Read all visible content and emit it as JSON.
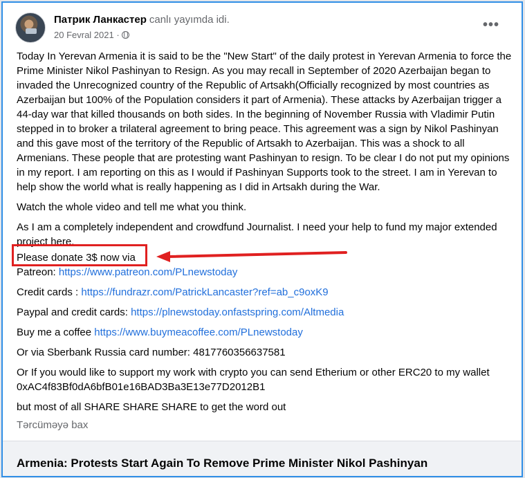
{
  "post": {
    "author_name": "Патрик Ланкастер",
    "author_status": "canlı yayımda idi.",
    "date": "20 Fevral 2021",
    "more_label": "•••",
    "paragraphs": {
      "p1": "Today In Yerevan Armenia it is said to be the  \"New Start\" of the daily protest in Yerevan Armenia to force the Prime Minister Nikol Pashinyan to Resign. As you may recall in September of 2020 Azerbaijan began to invaded the Unrecognized country of the Republic of Artsakh(Officially recognized by most countries as Azerbaijan but 100% of the Population considers it part of Armenia). These attacks by Azerbaijan trigger a 44-day war that killed thousands on both sides.  In the beginning of November Russia with Vladimir Putin stepped in to broker a trilateral agreement to bring peace.  This agreement was a sign by Nikol Pashinyan and this gave most of the territory of the Republic of Artsakh to Azerbaijan. This was a shock to all Armenians. These people that are protesting want Pashinyan to resign.  To be clear I do not put my opinions in my report. I am reporting on this as I would if Pashinyan Supports took to the street. I am in Yerevan to help show the world what is really happening as I did in Artsakh during the War.",
      "p2": "Watch the whole video and tell me what you think.",
      "p3": "As I am a completely independent and crowdfund Journalist. I need your help to fund my major extended project here.",
      "p4": "Please donate 3$ now via",
      "patreon_label": "Patreon: ",
      "patreon_link": "https://www.patreon.com/PLnewstoday",
      "cards_label": "Credit cards : ",
      "cards_link": "https://fundrazr.com/PatrickLancaster?ref=ab_c9oxK9",
      "paypal_label": "Paypal and credit cards: ",
      "paypal_link": "https://plnewstoday.onfastspring.com/Altmedia",
      "coffee_label": "Buy me a coffee ",
      "coffee_link": "https://www.buymeacoffee.com/PLnewstoday",
      "sberbank": "Or via Sberbank Russia card number: 4817760356637581",
      "crypto": "Or If you would like to support my work with crypto you can send Etherium or other ERC20 to my wallet 0xAC4f83Bf0dA6bfB01e16BAD3Ba3E13e77D2012B1",
      "share": "but most of all SHARE SHARE SHARE to get the word out"
    },
    "translate_label": "Tərcüməyə bax"
  },
  "preview": {
    "title": "Armenia: Protests Start Again To Remove Prime Minister Nikol Pashinyan"
  },
  "annotation": {
    "color": "#e02020"
  }
}
